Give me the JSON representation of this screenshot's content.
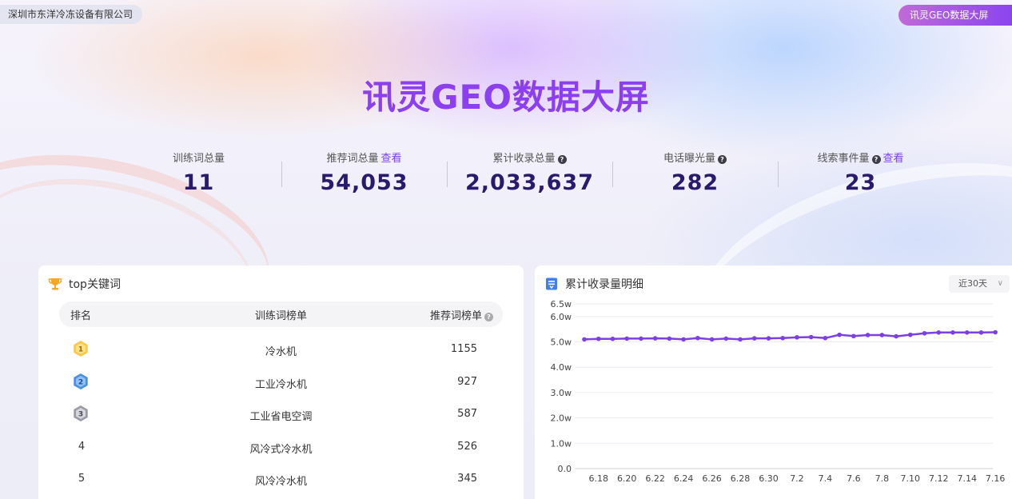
{
  "header": {
    "company": "深圳市东洋冷冻设备有限公司",
    "screen_button": "讯灵GEO数据大屏",
    "title": "讯灵GEO数据大屏"
  },
  "stats": [
    {
      "label": "训练词总量",
      "value": "11"
    },
    {
      "label": "推荐词总量",
      "link": "查看",
      "value": "54,053"
    },
    {
      "label": "累计收录总量",
      "value": "2,033,637"
    },
    {
      "label": "电话曝光量",
      "value": "282"
    },
    {
      "label": "线索事件量",
      "link": "查看",
      "value": "23"
    }
  ],
  "keywords": {
    "title": "top关键词",
    "columns": [
      "排名",
      "训练词榜单",
      "推荐词榜单"
    ],
    "rows": [
      {
        "rank": "1",
        "word": "冷水机",
        "count": "1155"
      },
      {
        "rank": "2",
        "word": "工业冷水机",
        "count": "927"
      },
      {
        "rank": "3",
        "word": "工业省电空调",
        "count": "587"
      },
      {
        "rank": "4",
        "word": "风冷式冷水机",
        "count": "526"
      },
      {
        "rank": "5",
        "word": "风冷冷水机",
        "count": "345"
      }
    ]
  },
  "detail": {
    "title": "累计收录量明细",
    "range": "近30天"
  },
  "colors": {
    "accent": "#8b3ff0",
    "line": "#7b3fe4"
  },
  "chart_data": {
    "type": "line",
    "x": [
      "6.17",
      "6.18",
      "6.19",
      "6.20",
      "6.21",
      "6.22",
      "6.23",
      "6.24",
      "6.25",
      "6.26",
      "6.27",
      "6.28",
      "6.29",
      "6.30",
      "7.1",
      "7.2",
      "7.3",
      "7.4",
      "7.5",
      "7.6",
      "7.7",
      "7.8",
      "7.9",
      "7.10",
      "7.11",
      "7.12",
      "7.13",
      "7.14",
      "7.15",
      "7.16"
    ],
    "x_tick_labels": [
      "6.18",
      "6.20",
      "6.22",
      "6.24",
      "6.26",
      "6.28",
      "6.30",
      "7.2",
      "7.4",
      "7.6",
      "7.8",
      "7.10",
      "7.12",
      "7.14",
      "7.16"
    ],
    "series": [
      {
        "values": [
          5.1,
          5.12,
          5.12,
          5.13,
          5.13,
          5.14,
          5.13,
          5.1,
          5.15,
          5.1,
          5.13,
          5.1,
          5.14,
          5.14,
          5.15,
          5.18,
          5.19,
          5.15,
          5.28,
          5.23,
          5.27,
          5.27,
          5.22,
          5.28,
          5.34,
          5.37,
          5.37,
          5.37,
          5.37,
          5.38
        ]
      }
    ],
    "y_ticks": [
      "0.0",
      "1.0w",
      "2.0w",
      "3.0w",
      "4.0w",
      "5.0w",
      "6.0w",
      "6.5w"
    ],
    "ylim": [
      0,
      6.5
    ],
    "grid": true
  }
}
